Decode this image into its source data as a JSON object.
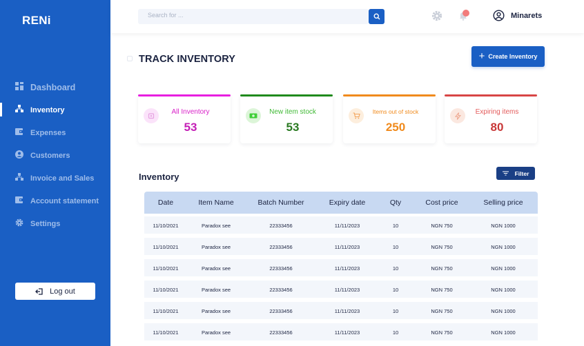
{
  "app": {
    "logo": "RENi"
  },
  "sidebar": {
    "items": [
      {
        "label": "Dashboard",
        "icon": "dashboard-icon",
        "active": false
      },
      {
        "label": "Inventory",
        "icon": "inventory-icon",
        "active": true
      },
      {
        "label": "Expenses",
        "icon": "wallet-icon",
        "active": false
      },
      {
        "label": "Customers",
        "icon": "user-icon",
        "active": false
      },
      {
        "label": "Invoice and Sales",
        "icon": "invoice-icon",
        "active": false
      },
      {
        "label": "Account statement",
        "icon": "statement-icon",
        "active": false
      },
      {
        "label": "Settings",
        "icon": "gear-icon",
        "active": false
      }
    ],
    "logout_label": "Log out"
  },
  "topbar": {
    "search_placeholder": "Search for ...",
    "user_name": "Minarets"
  },
  "page": {
    "title": "TRACK INVENTORY",
    "create_button": "Create Inventory"
  },
  "stats": [
    {
      "label": "All Inventory",
      "value": "53",
      "color": "#d920c8",
      "bar": "#e81ee0"
    },
    {
      "label": "New item stock",
      "value": "53",
      "color": "#2a8a22",
      "bar": "#1f8a1c"
    },
    {
      "label": "Items out of stock",
      "value": "250",
      "color": "#f08a1c",
      "bar": "#f08a1c"
    },
    {
      "label": "Expiring items",
      "value": "80",
      "color": "#d84545",
      "bar": "#d84545"
    }
  ],
  "inventory": {
    "title": "Inventory",
    "filter_label": "Filter",
    "columns": [
      "Date",
      "Item Name",
      "Batch Number",
      "Expiry date",
      "Qty",
      "Cost price",
      "Selling price"
    ],
    "rows": [
      [
        "11/10/2021",
        "Paradox see",
        "22333456",
        "11/11/2023",
        "10",
        "NGN 750",
        "NGN 1000"
      ],
      [
        "11/10/2021",
        "Paradox see",
        "22333456",
        "11/11/2023",
        "10",
        "NGN 750",
        "NGN 1000"
      ],
      [
        "11/10/2021",
        "Paradox see",
        "22333456",
        "11/11/2023",
        "10",
        "NGN 750",
        "NGN 1000"
      ],
      [
        "11/10/2021",
        "Paradox see",
        "22333456",
        "11/11/2023",
        "10",
        "NGN 750",
        "NGN 1000"
      ],
      [
        "11/10/2021",
        "Paradox see",
        "22333456",
        "11/11/2023",
        "10",
        "NGN 750",
        "NGN 1000"
      ],
      [
        "11/10/2021",
        "Paradox see",
        "22333456",
        "11/11/2023",
        "10",
        "NGN 750",
        "NGN 1000"
      ]
    ]
  },
  "colors": {
    "primary": "#1a5fc4",
    "sidebar": "#1a5fc4",
    "table_header": "#c8d9f2",
    "filter": "#1a3f85"
  }
}
